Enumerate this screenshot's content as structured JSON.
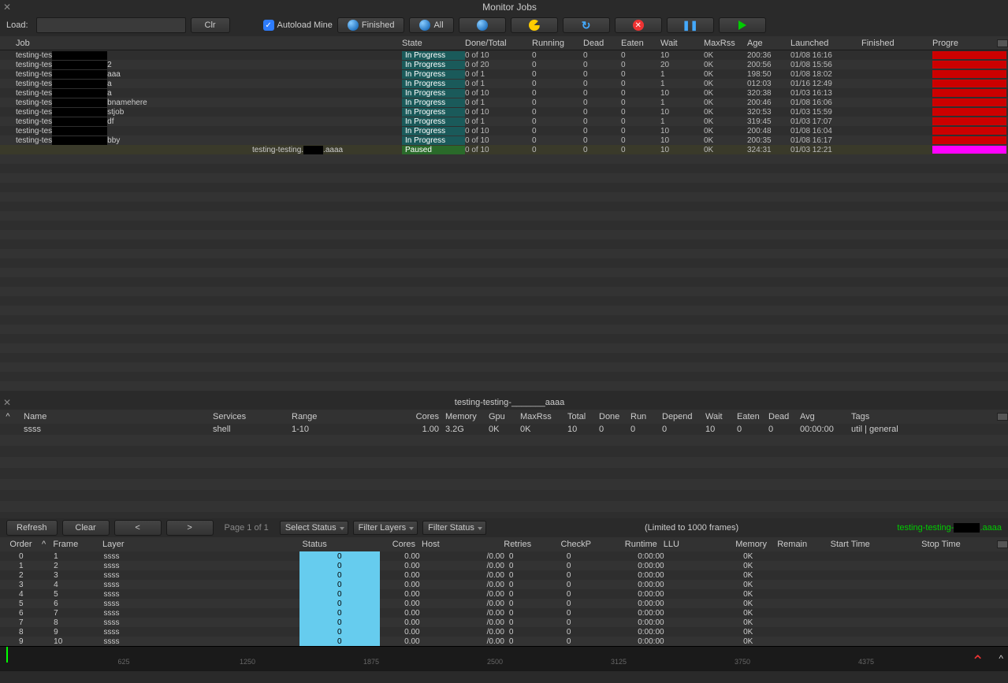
{
  "window": {
    "title": "Monitor Jobs"
  },
  "toolbar": {
    "load_label": "Load:",
    "clr": "Clr",
    "autoload": "Autoload Mine",
    "finished": "Finished",
    "all": "All"
  },
  "jobs_header": [
    "Job",
    "",
    "State",
    "Done/Total",
    "Running",
    "Dead",
    "Eaten",
    "Wait",
    "MaxRss",
    "Age",
    "Launched",
    "Finished",
    "Progre"
  ],
  "jobs": [
    {
      "name": "testing-tes",
      "state": "In Progress",
      "dt": "0 of 10",
      "run": "0",
      "dead": "0",
      "eat": "0",
      "wait": "10",
      "rss": "0K",
      "age": "200:36",
      "launch": "01/08 16:16"
    },
    {
      "name": "testing-tes",
      "suffix": "2",
      "state": "In Progress",
      "dt": "0 of 20",
      "run": "0",
      "dead": "0",
      "eat": "0",
      "wait": "20",
      "rss": "0K",
      "age": "200:56",
      "launch": "01/08 15:56"
    },
    {
      "name": "testing-tes",
      "suffix": "aaa",
      "state": "In Progress",
      "dt": "0 of 1",
      "run": "0",
      "dead": "0",
      "eat": "0",
      "wait": "1",
      "rss": "0K",
      "age": "198:50",
      "launch": "01/08 18:02"
    },
    {
      "name": "testing-tes",
      "suffix": "a",
      "state": "In Progress",
      "dt": "0 of 1",
      "run": "0",
      "dead": "0",
      "eat": "0",
      "wait": "1",
      "rss": "0K",
      "age": "012:03",
      "launch": "01/16 12:49"
    },
    {
      "name": "testing-tes",
      "suffix": "a",
      "state": "In Progress",
      "dt": "0 of 10",
      "run": "0",
      "dead": "0",
      "eat": "0",
      "wait": "10",
      "rss": "0K",
      "age": "320:38",
      "launch": "01/03 16:13"
    },
    {
      "name": "testing-tes",
      "suffix": "bnamehere",
      "state": "In Progress",
      "dt": "0 of 1",
      "run": "0",
      "dead": "0",
      "eat": "0",
      "wait": "1",
      "rss": "0K",
      "age": "200:46",
      "launch": "01/08 16:06"
    },
    {
      "name": "testing-tes",
      "suffix": "stjob",
      "state": "In Progress",
      "dt": "0 of 10",
      "run": "0",
      "dead": "0",
      "eat": "0",
      "wait": "10",
      "rss": "0K",
      "age": "320:53",
      "launch": "01/03 15:59"
    },
    {
      "name": "testing-tes",
      "suffix": "df",
      "state": "In Progress",
      "dt": "0 of 1",
      "run": "0",
      "dead": "0",
      "eat": "0",
      "wait": "1",
      "rss": "0K",
      "age": "319:45",
      "launch": "01/03 17:07"
    },
    {
      "name": "testing-tes",
      "state": "In Progress",
      "dt": "0 of 10",
      "run": "0",
      "dead": "0",
      "eat": "0",
      "wait": "10",
      "rss": "0K",
      "age": "200:48",
      "launch": "01/08 16:04"
    },
    {
      "name": "testing-tes",
      "suffix": "bby",
      "state": "In Progress",
      "dt": "0 of 10",
      "run": "0",
      "dead": "0",
      "eat": "0",
      "wait": "10",
      "rss": "0K",
      "age": "200:35",
      "launch": "01/08 16:17"
    },
    {
      "name": "testing-testing.",
      "suffix": ".aaaa",
      "state": "Paused",
      "dt": "0 of 10",
      "run": "0",
      "dead": "0",
      "eat": "0",
      "wait": "10",
      "rss": "0K",
      "age": "324:31",
      "launch": "01/03 12:21",
      "selected": true,
      "paused": true
    }
  ],
  "mid_title": "testing-testing-_______aaaa",
  "layers_header": [
    "^",
    "Name",
    "Services",
    "Range",
    "Cores",
    "Memory",
    "Gpu",
    "MaxRss",
    "Total",
    "Done",
    "Run",
    "Depend",
    "Wait",
    "Eaten",
    "Dead",
    "Avg",
    "Tags"
  ],
  "layer_row": {
    "name": "ssss",
    "srv": "shell",
    "range": "1-10",
    "cores": "1.00",
    "mem": "3.2G",
    "gpu": "0K",
    "mrss": "0K",
    "total": "10",
    "done": "0",
    "run": "0",
    "dep": "0",
    "wait": "10",
    "eat": "0",
    "dead": "0",
    "avg": "00:00:00",
    "tags": "util | general"
  },
  "frames_toolbar": {
    "refresh": "Refresh",
    "clear": "Clear",
    "prev": "<",
    "next": ">",
    "page": "Page 1 of 1",
    "select_status": "Select Status",
    "filter_layers": "Filter Layers",
    "filter_status": "Filter Status",
    "limit": "(Limited to 1000 frames)",
    "job_link": "testing-testing-",
    "job_suffix": ".aaaa"
  },
  "frames_header": [
    "Order",
    "^",
    "Frame",
    "Layer",
    "Status",
    "Cores",
    "Host",
    "Retries",
    "CheckP",
    "Runtime",
    "LLU",
    "Memory",
    "Remain",
    "Start Time",
    "Stop Time"
  ],
  "frames": [
    {
      "order": "0",
      "frame": "1",
      "layer": "ssss",
      "status": "0",
      "cores": "0.00",
      "host": "/0.00",
      "retry": "0",
      "chk": "0",
      "rt": "0:00:00",
      "mem": "0K"
    },
    {
      "order": "1",
      "frame": "2",
      "layer": "ssss",
      "status": "0",
      "cores": "0.00",
      "host": "/0.00",
      "retry": "0",
      "chk": "0",
      "rt": "0:00:00",
      "mem": "0K"
    },
    {
      "order": "2",
      "frame": "3",
      "layer": "ssss",
      "status": "0",
      "cores": "0.00",
      "host": "/0.00",
      "retry": "0",
      "chk": "0",
      "rt": "0:00:00",
      "mem": "0K"
    },
    {
      "order": "3",
      "frame": "4",
      "layer": "ssss",
      "status": "0",
      "cores": "0.00",
      "host": "/0.00",
      "retry": "0",
      "chk": "0",
      "rt": "0:00:00",
      "mem": "0K"
    },
    {
      "order": "4",
      "frame": "5",
      "layer": "ssss",
      "status": "0",
      "cores": "0.00",
      "host": "/0.00",
      "retry": "0",
      "chk": "0",
      "rt": "0:00:00",
      "mem": "0K"
    },
    {
      "order": "5",
      "frame": "6",
      "layer": "ssss",
      "status": "0",
      "cores": "0.00",
      "host": "/0.00",
      "retry": "0",
      "chk": "0",
      "rt": "0:00:00",
      "mem": "0K"
    },
    {
      "order": "6",
      "frame": "7",
      "layer": "ssss",
      "status": "0",
      "cores": "0.00",
      "host": "/0.00",
      "retry": "0",
      "chk": "0",
      "rt": "0:00:00",
      "mem": "0K"
    },
    {
      "order": "7",
      "frame": "8",
      "layer": "ssss",
      "status": "0",
      "cores": "0.00",
      "host": "/0.00",
      "retry": "0",
      "chk": "0",
      "rt": "0:00:00",
      "mem": "0K"
    },
    {
      "order": "8",
      "frame": "9",
      "layer": "ssss",
      "status": "0",
      "cores": "0.00",
      "host": "/0.00",
      "retry": "0",
      "chk": "0",
      "rt": "0:00:00",
      "mem": "0K"
    },
    {
      "order": "9",
      "frame": "10",
      "layer": "ssss",
      "status": "0",
      "cores": "0.00",
      "host": "/0.00",
      "retry": "0",
      "chk": "0",
      "rt": "0:00:00",
      "mem": "0K"
    }
  ],
  "timeline_labels": [
    "625",
    "1250",
    "1875",
    "2500",
    "3125",
    "3750",
    "4375"
  ]
}
